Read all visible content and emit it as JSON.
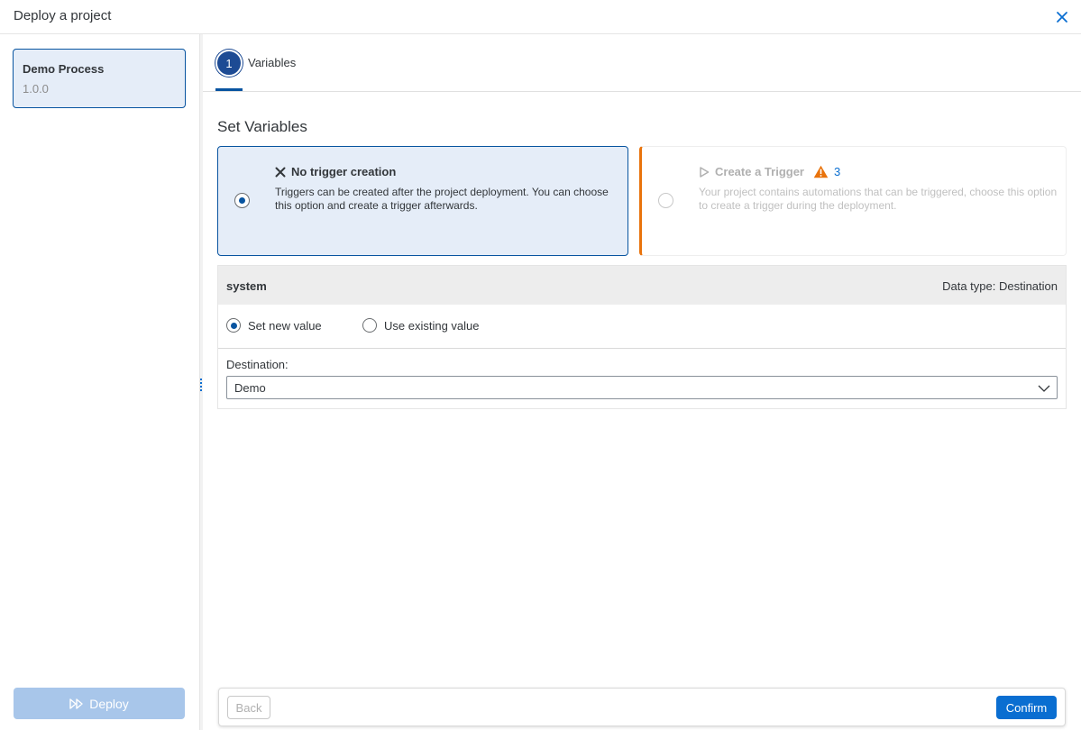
{
  "dialog": {
    "title": "Deploy a project"
  },
  "sidebar": {
    "project": {
      "name": "Demo Process",
      "version": "1.0.0"
    },
    "deploy_label": "Deploy"
  },
  "steps": [
    {
      "number": "1",
      "label": "Variables"
    }
  ],
  "main": {
    "section_title": "Set Variables",
    "options": [
      {
        "title": "No trigger creation",
        "description": "Triggers can be created after the project deployment. You can choose this option and create a trigger afterwards.",
        "selected": true,
        "icon": "x-icon"
      },
      {
        "title": "Create a Trigger",
        "description": "Your project contains automations that can be triggered, choose this option to create a trigger during the deployment.",
        "selected": false,
        "disabled": true,
        "icon": "play-outline-icon",
        "warning_count": "3"
      }
    ],
    "variable": {
      "name": "system",
      "data_type": "Data type: Destination",
      "value_modes": [
        {
          "label": "Set new value",
          "selected": true
        },
        {
          "label": "Use existing value",
          "selected": false
        }
      ],
      "destination_label": "Destination:",
      "destination_value": "Demo"
    }
  },
  "footer": {
    "back_label": "Back",
    "confirm_label": "Confirm"
  },
  "colors": {
    "accent": "#0854a0",
    "button": "#0a6ed1",
    "warning": "#e9730c",
    "selected_bg": "#e5edf8"
  }
}
